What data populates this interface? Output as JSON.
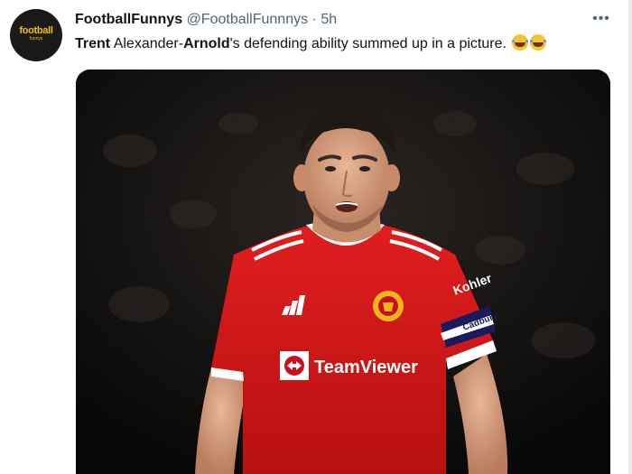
{
  "tweet": {
    "display_name": "FootballFunnys",
    "handle": "@FootballFunnnys",
    "separator": "·",
    "time": "5h",
    "more_label": "•••",
    "avatar_text": "football",
    "avatar_subtext": "funnys",
    "text_parts": {
      "bold_1": "Trent",
      "plain_1": " Alexander-",
      "bold_2": "Arnold",
      "plain_2": "'s defending ability summed up in a picture."
    },
    "emojis": [
      "rolling-on-floor-laughing",
      "rolling-on-floor-laughing"
    ],
    "photo": {
      "shirt_sponsor": "TeamViewer",
      "kit_brand_mark": "Kohler",
      "armband_text": "Cadbury"
    }
  },
  "colors": {
    "text": "#0f1419",
    "secondary": "#536471",
    "shirt_red": "#d81a1a",
    "avatar_bg": "#1a1a1a",
    "avatar_accent": "#f2c200"
  }
}
